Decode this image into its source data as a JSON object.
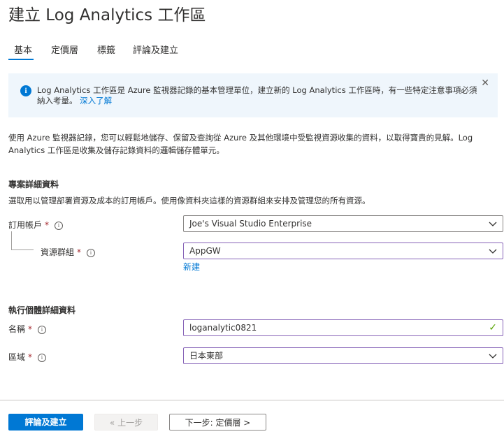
{
  "page_title": "建立 Log Analytics 工作區",
  "tabs": [
    {
      "label": "基本",
      "active": true
    },
    {
      "label": "定價層",
      "active": false
    },
    {
      "label": "標籤",
      "active": false
    },
    {
      "label": "評論及建立",
      "active": false
    }
  ],
  "info_banner": {
    "text": "Log Analytics 工作區是 Azure 監視器記錄的基本管理單位，建立新的 Log Analytics 工作區時，有一些特定注意事項必須納入考量。",
    "link": "深入了解",
    "close_icon": "close-icon"
  },
  "description": "使用 Azure 監視器記錄，您可以輕鬆地儲存、保留及查詢從 Azure 及其他環境中受監視資源收集的資料，以取得寶貴的見解。Log Analytics 工作區是收集及儲存記錄資料的邏輯儲存體單元。",
  "project_details": {
    "heading": "專案詳細資料",
    "subtext": "選取用以管理部署資源及成本的訂用帳戶。使用像資料夾這樣的資源群組來安排及管理您的所有資源。",
    "subscription": {
      "label": "訂用帳戶",
      "required": "*",
      "value": "Joe's Visual Studio Enterprise"
    },
    "resource_group": {
      "label": "資源群組",
      "required": "*",
      "value": "AppGW",
      "new_link": "新建"
    }
  },
  "instance_details": {
    "heading": "執行個體詳細資料",
    "name": {
      "label": "名稱",
      "required": "*",
      "value": "loganalytic0821"
    },
    "region": {
      "label": "區域",
      "required": "*",
      "value": "日本東部"
    }
  },
  "footer": {
    "review_create": "評論及建立",
    "previous": "« 上一步",
    "next": "下一步: 定價層 >"
  },
  "colors": {
    "accent": "#0078d4",
    "required": "#a4262c",
    "valid_check": "#57a300",
    "focus_border": "#8764b8",
    "info_bg": "#eff6fc"
  }
}
